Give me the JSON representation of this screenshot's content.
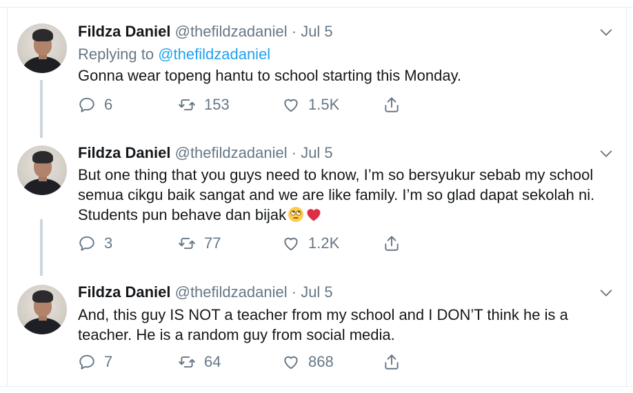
{
  "tweets": [
    {
      "name": "Fildza Daniel",
      "handle": "@thefildzadaniel",
      "separator": "·",
      "date": "Jul 5",
      "replying_prefix": "Replying to",
      "replying_to": "@thefildzadaniel",
      "text": "Gonna wear topeng hantu to school starting this Monday.",
      "replies": "6",
      "retweets": "153",
      "likes": "1.5K"
    },
    {
      "name": "Fildza Daniel",
      "handle": "@thefildzadaniel",
      "separator": "·",
      "date": "Jul 5",
      "text": "But one thing that you guys need to know, I’m so bersyukur sebab my school semua cikgu baik sangat and we are like family. I’m so glad dapat sekolah ni. Students pun behave dan bijak",
      "emojis": [
        "face-with-rolling-eyes-emoji",
        "red-heart-emoji"
      ],
      "replies": "3",
      "retweets": "77",
      "likes": "1.2K"
    },
    {
      "name": "Fildza Daniel",
      "handle": "@thefildzadaniel",
      "separator": "·",
      "date": "Jul 5",
      "text": "And, this guy IS NOT a teacher from my school and I DON’T think he is a teacher. He is a random guy from social media.",
      "replies": "7",
      "retweets": "64",
      "likes": "868"
    }
  ],
  "colors": {
    "text": "#14171a",
    "secondary": "#657786",
    "link": "#1da1f2",
    "thread_line": "#ccd6dd",
    "heart": "#e0245e"
  },
  "icons": [
    "reply-icon",
    "retweet-icon",
    "like-icon",
    "share-icon",
    "chevron-down-icon"
  ]
}
